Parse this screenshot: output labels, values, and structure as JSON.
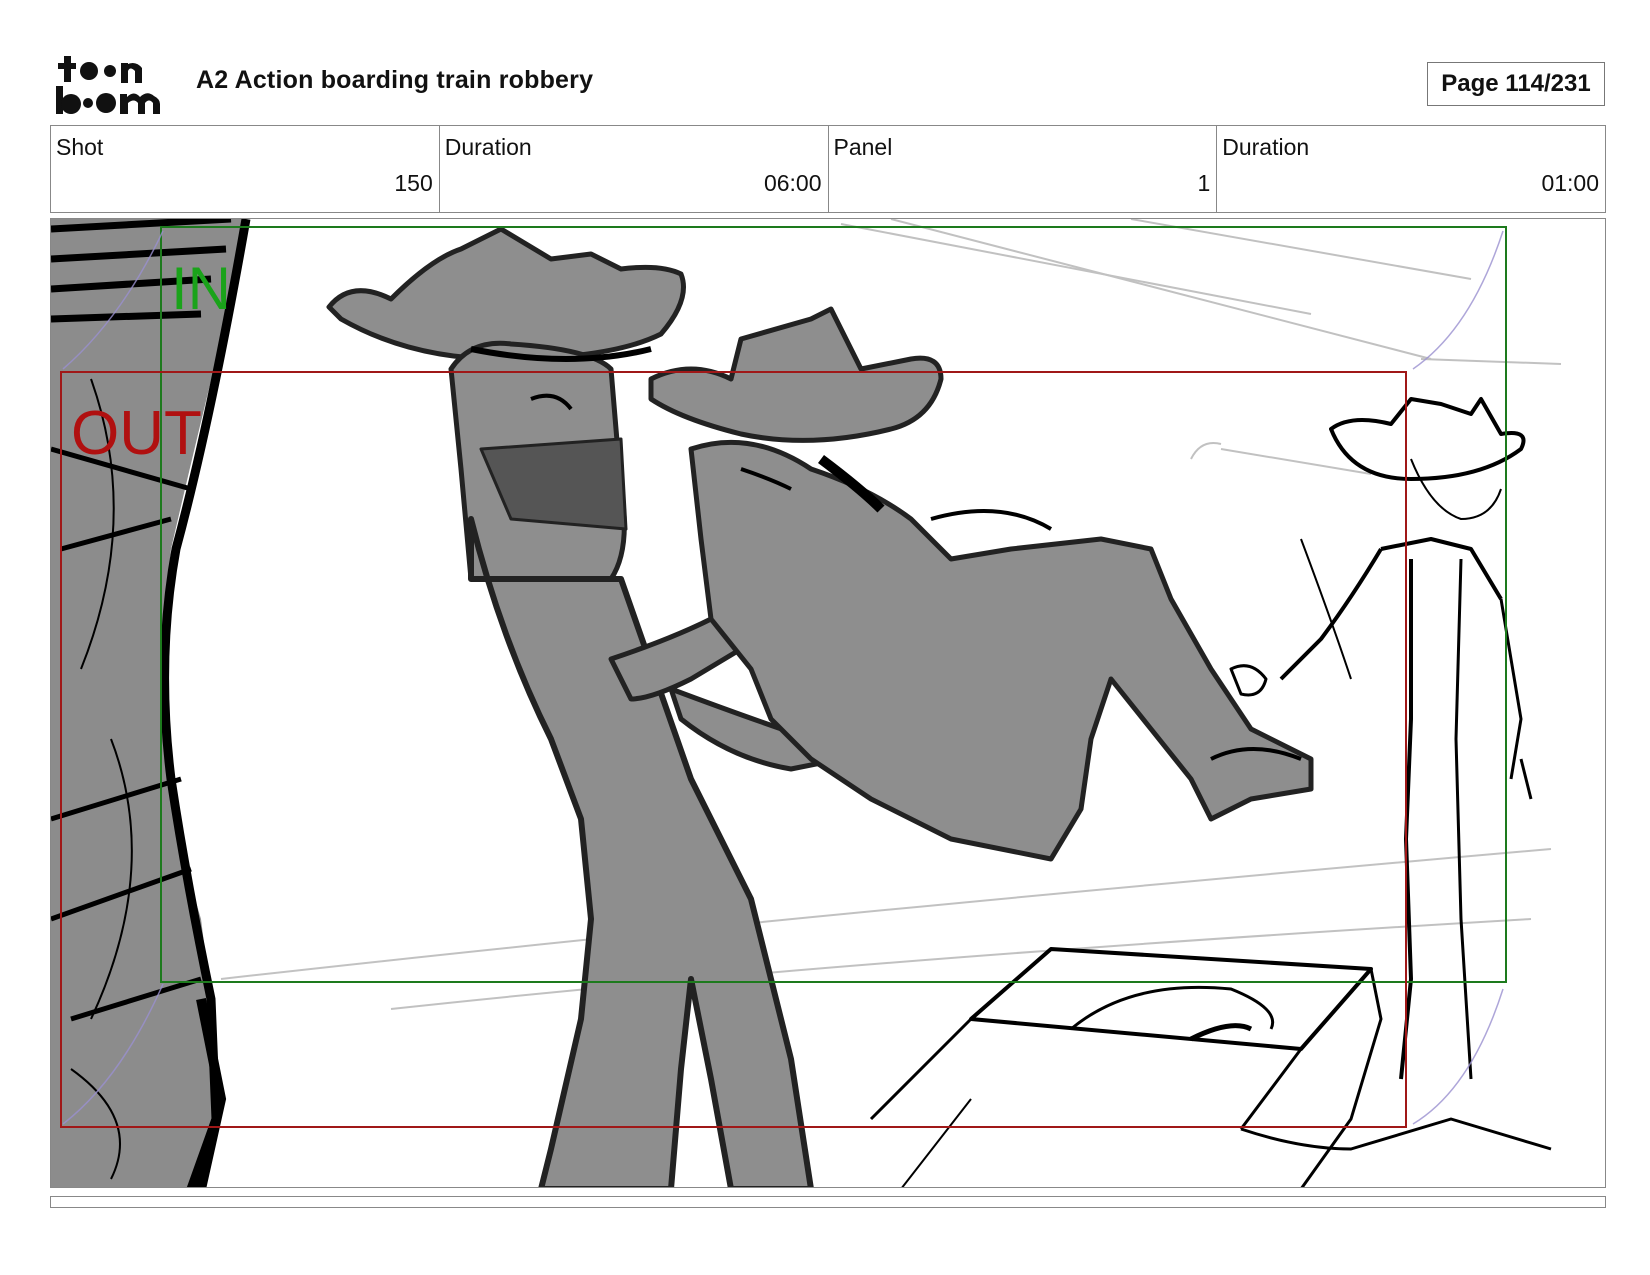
{
  "header": {
    "title": "A2 Action boarding train robbery",
    "page": "Page 114/231"
  },
  "info": [
    {
      "label": "Shot",
      "value": "150"
    },
    {
      "label": "Duration",
      "value": "06:00"
    },
    {
      "label": "Panel",
      "value": "1"
    },
    {
      "label": "Duration",
      "value": "01:00"
    }
  ],
  "panel": {
    "in_label": "IN",
    "out_label": "OUT",
    "in_color": "#1aa31a",
    "out_color": "#b01010"
  }
}
